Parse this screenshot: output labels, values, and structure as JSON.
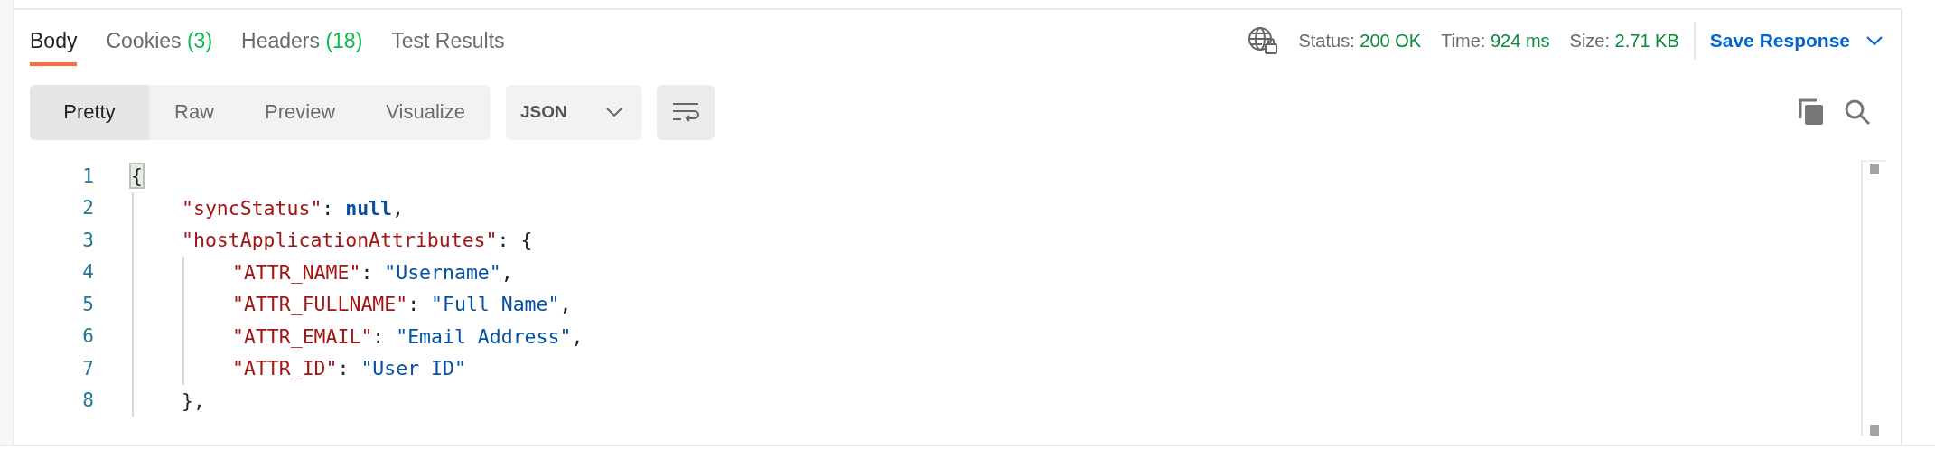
{
  "tabs": [
    {
      "label": "Body",
      "selected": true
    },
    {
      "label": "Cookies",
      "count": "(3)",
      "selected": false
    },
    {
      "label": "Headers",
      "count": "(18)",
      "selected": false
    },
    {
      "label": "Test Results",
      "selected": false
    }
  ],
  "status": [
    {
      "label": "Status:",
      "value": "200 OK"
    },
    {
      "label": "Time:",
      "value": "924 ms"
    },
    {
      "label": "Size:",
      "value": "2.71 KB"
    }
  ],
  "save_response": "Save Response",
  "view_modes": [
    {
      "label": "Pretty",
      "selected": true
    },
    {
      "label": "Raw",
      "selected": false
    },
    {
      "label": "Preview",
      "selected": false
    },
    {
      "label": "Visualize",
      "selected": false
    }
  ],
  "format": "JSON",
  "code_lines": [
    {
      "number": "1",
      "tokens": [
        {
          "kind": "punct",
          "text": "{",
          "highlighted": true
        }
      ],
      "children": [
        {
          "number": "2",
          "tokens": [
            {
              "kind": "key",
              "text": "\"syncStatus\""
            },
            {
              "kind": "punct",
              "text": ": "
            },
            {
              "kind": "keyword",
              "text": "null"
            },
            {
              "kind": "punct",
              "text": ","
            }
          ]
        },
        {
          "number": "3",
          "tokens": [
            {
              "kind": "key",
              "text": "\"hostApplicationAttributes\""
            },
            {
              "kind": "punct",
              "text": ": {"
            }
          ],
          "children": [
            {
              "number": "4",
              "tokens": [
                {
                  "kind": "key",
                  "text": "\"ATTR_NAME\""
                },
                {
                  "kind": "punct",
                  "text": ": "
                },
                {
                  "kind": "string",
                  "text": "\"Username\""
                },
                {
                  "kind": "punct",
                  "text": ","
                }
              ]
            },
            {
              "number": "5",
              "tokens": [
                {
                  "kind": "key",
                  "text": "\"ATTR_FULLNAME\""
                },
                {
                  "kind": "punct",
                  "text": ": "
                },
                {
                  "kind": "string",
                  "text": "\"Full Name\""
                },
                {
                  "kind": "punct",
                  "text": ","
                }
              ]
            },
            {
              "number": "6",
              "tokens": [
                {
                  "kind": "key",
                  "text": "\"ATTR_EMAIL\""
                },
                {
                  "kind": "punct",
                  "text": ": "
                },
                {
                  "kind": "string",
                  "text": "\"Email Address\""
                },
                {
                  "kind": "punct",
                  "text": ","
                }
              ]
            },
            {
              "number": "7",
              "tokens": [
                {
                  "kind": "key",
                  "text": "\"ATTR_ID\""
                },
                {
                  "kind": "punct",
                  "text": ": "
                },
                {
                  "kind": "string",
                  "text": "\"User ID\""
                }
              ]
            }
          ]
        },
        {
          "number": "8",
          "tokens": [
            {
              "kind": "punct",
              "text": "},"
            }
          ]
        }
      ]
    }
  ]
}
